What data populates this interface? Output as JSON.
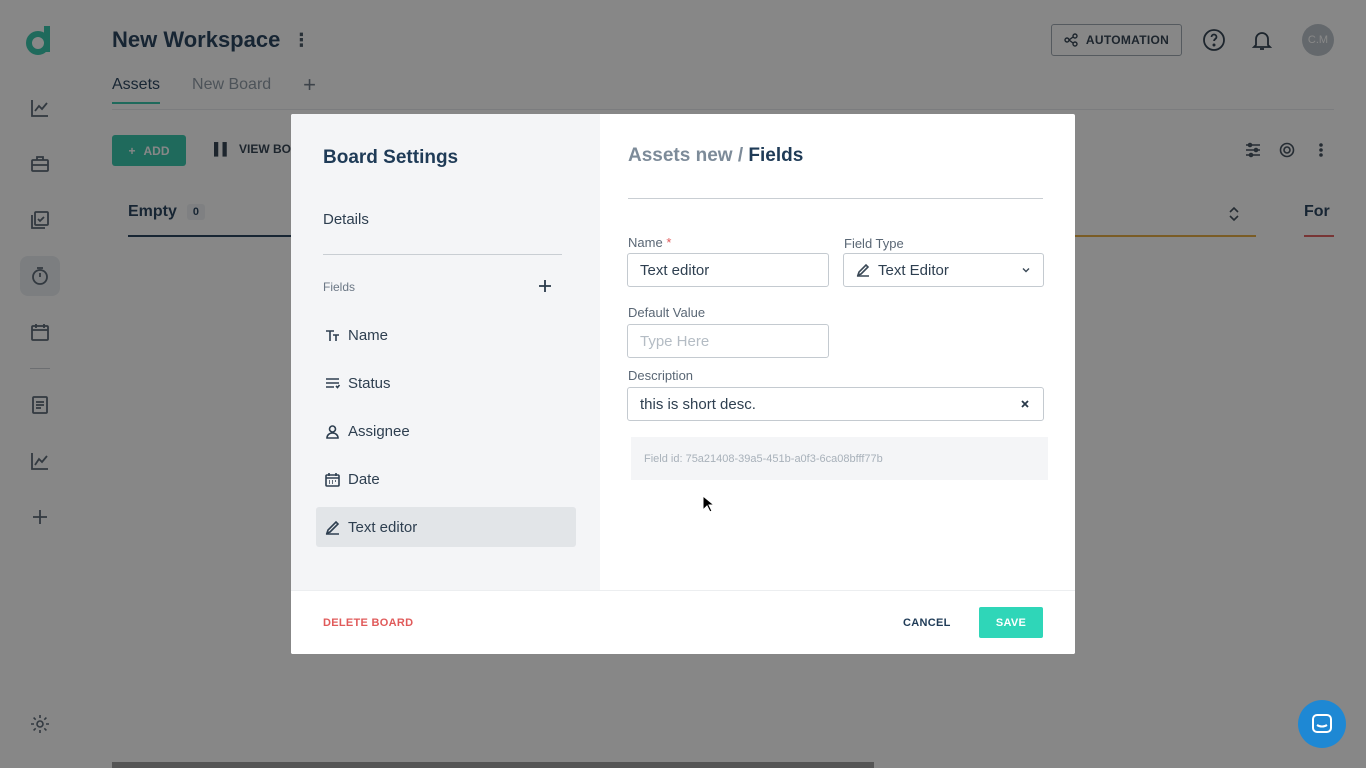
{
  "workspace": {
    "title": "New Workspace"
  },
  "tabs": [
    {
      "label": "Assets",
      "active": true
    },
    {
      "label": "New Board",
      "active": false
    }
  ],
  "header": {
    "automation_label": "AUTOMATION",
    "avatar_initials": "C.M"
  },
  "toolbar": {
    "add_label": "ADD",
    "view_board_label": "VIEW BOA"
  },
  "columns": [
    {
      "label": "Empty",
      "count": "0",
      "line_color": "#1f3b57"
    },
    {
      "label": "For",
      "line_color": "#e05a5a"
    }
  ],
  "modal": {
    "title": "Board Settings",
    "details_label": "Details",
    "fields_label": "Fields",
    "fields": [
      {
        "label": "Name",
        "icon": "text-type-icon"
      },
      {
        "label": "Status",
        "icon": "status-list-icon"
      },
      {
        "label": "Assignee",
        "icon": "user-icon"
      },
      {
        "label": "Date",
        "icon": "calendar-icon"
      },
      {
        "label": "Text editor",
        "icon": "pencil-icon",
        "selected": true
      }
    ],
    "breadcrumb": {
      "parent": "Assets new",
      "separator": " / ",
      "current": "Fields"
    },
    "form": {
      "name_label": "Name",
      "name_required": "*",
      "name_value": "Text editor",
      "field_type_label": "Field Type",
      "field_type_value": "Text Editor",
      "default_value_label": "Default Value",
      "default_value_placeholder": "Type Here",
      "description_label": "Description",
      "description_value": "this is short desc.",
      "field_id_text": "Field id: 75a21408-39a5-451b-a0f3-6ca08bfff77b"
    },
    "footer": {
      "delete_label": "DELETE BOARD",
      "cancel_label": "CANCEL",
      "save_label": "SAVE"
    }
  },
  "colors": {
    "accent": "#2fc4a8",
    "danger": "#e05a5a",
    "text_dark": "#1f3b57",
    "chat": "#1e88d4"
  }
}
